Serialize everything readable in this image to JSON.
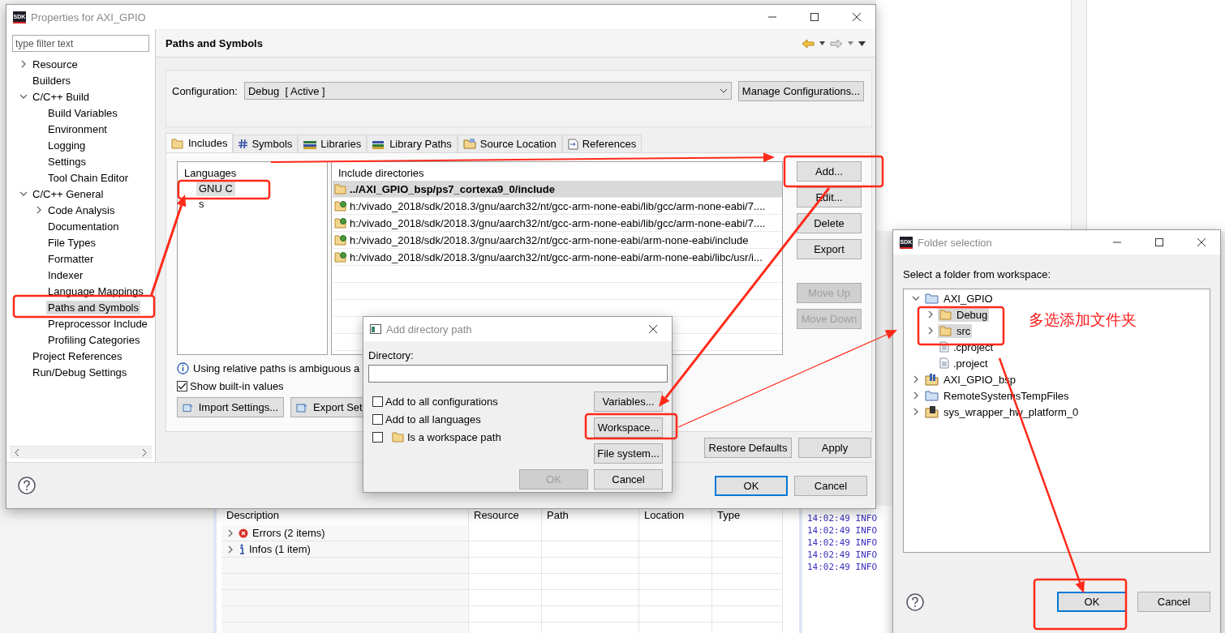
{
  "background": {
    "problems": {
      "columns": [
        "Description",
        "Resource",
        "Path",
        "Location",
        "Type"
      ],
      "rows": [
        {
          "label": "Errors (2 items)",
          "kind": "error"
        },
        {
          "label": "Infos (1 item)",
          "kind": "info"
        }
      ]
    },
    "console_lines": [
      "14:02:49 INFO",
      "14:02:49 INFO",
      "14:02:49 INFO",
      "14:02:49 INFO",
      "14:02:49 INFO"
    ]
  },
  "main_window": {
    "app_badge": "SDK",
    "title": "Properties for AXI_GPIO",
    "filter": {
      "placeholder": "type filter text"
    },
    "nav_tree": [
      {
        "label": "Resource",
        "expanded": false,
        "selected": false
      },
      {
        "label": "Builders",
        "selected": false
      },
      {
        "label": "C/C++ Build",
        "expanded": true,
        "selected": false,
        "children": [
          {
            "label": "Build Variables",
            "selected": false
          },
          {
            "label": "Environment",
            "selected": false
          },
          {
            "label": "Logging",
            "selected": false
          },
          {
            "label": "Settings",
            "selected": false
          },
          {
            "label": "Tool Chain Editor",
            "selected": false
          }
        ]
      },
      {
        "label": "C/C++ General",
        "expanded": true,
        "selected": false,
        "children": [
          {
            "label": "Code Analysis",
            "expanded": false,
            "selected": false
          },
          {
            "label": "Documentation",
            "selected": false
          },
          {
            "label": "File Types",
            "selected": false
          },
          {
            "label": "Formatter",
            "selected": false
          },
          {
            "label": "Indexer",
            "selected": false
          },
          {
            "label": "Language Mappings",
            "selected": false
          },
          {
            "label": "Paths and Symbols",
            "selected": true
          },
          {
            "label": "Preprocessor Include",
            "selected": false
          },
          {
            "label": "Profiling Categories",
            "selected": false
          }
        ]
      },
      {
        "label": "Project References",
        "selected": false
      },
      {
        "label": "Run/Debug Settings",
        "selected": false
      }
    ],
    "page_title": "Paths and Symbols",
    "configuration": {
      "label": "Configuration:",
      "value": "Debug  [ Active ]",
      "manage_button": "Manage Configurations..."
    },
    "tabs": [
      {
        "label": "Includes",
        "selected": true
      },
      {
        "label": "Symbols",
        "selected": false
      },
      {
        "label": "Libraries",
        "selected": false
      },
      {
        "label": "Library Paths",
        "selected": false
      },
      {
        "label": "Source Location",
        "selected": false
      },
      {
        "label": "References",
        "selected": false
      }
    ],
    "languages": {
      "header": "Languages",
      "items": [
        {
          "label": "GNU C",
          "selected": true
        },
        {
          "label": "s",
          "selected": false
        }
      ]
    },
    "include_directories": {
      "header": "Include directories",
      "rows": [
        {
          "path": "../AXI_GPIO_bsp/ps7_cortexa9_0/include",
          "kind": "workspace",
          "selected": true
        },
        {
          "path": "h:/vivado_2018/sdk/2018.3/gnu/aarch32/nt/gcc-arm-none-eabi/lib/gcc/arm-none-eabi/7....",
          "kind": "builtin",
          "selected": false
        },
        {
          "path": "h:/vivado_2018/sdk/2018.3/gnu/aarch32/nt/gcc-arm-none-eabi/lib/gcc/arm-none-eabi/7....",
          "kind": "builtin",
          "selected": false
        },
        {
          "path": "h:/vivado_2018/sdk/2018.3/gnu/aarch32/nt/gcc-arm-none-eabi/arm-none-eabi/include",
          "kind": "builtin",
          "selected": false
        },
        {
          "path": "h:/vivado_2018/sdk/2018.3/gnu/aarch32/nt/gcc-arm-none-eabi/arm-none-eabi/libc/usr/i...",
          "kind": "builtin",
          "selected": false
        }
      ]
    },
    "side_buttons": [
      {
        "label": "Add...",
        "disabled": false
      },
      {
        "label": "Edit...",
        "disabled": false
      },
      {
        "label": "Delete",
        "disabled": false
      },
      {
        "label": "Export",
        "disabled": false
      },
      {
        "label": "Move Up",
        "disabled": true
      },
      {
        "label": "Move Down",
        "disabled": true
      }
    ],
    "info": "Using relative paths is ambiguous a",
    "show_builtin": {
      "label": "Show built-in values",
      "checked": true
    },
    "import_button": "Import Settings...",
    "export_button": "Export Set",
    "restore_button": "Restore Defaults",
    "apply_button": "Apply",
    "ok_button": "OK",
    "cancel_button": "Cancel"
  },
  "add_dialog": {
    "title": "Add directory path",
    "directory_label": "Directory:",
    "options": [
      {
        "label": "Add to all configurations",
        "checked": false,
        "kind": "plain"
      },
      {
        "label": "Add to all languages",
        "checked": false,
        "kind": "plain"
      },
      {
        "label": "Is a workspace path",
        "checked": false,
        "kind": "folder"
      }
    ],
    "buttons": [
      "Variables...",
      "Workspace...",
      "File system..."
    ],
    "ok": {
      "label": "OK",
      "disabled": true
    },
    "cancel": "Cancel"
  },
  "folder_dialog": {
    "app_badge": "SDK",
    "title": "Folder selection",
    "prompt": "Select a folder from workspace:",
    "tree": [
      {
        "label": "AXI_GPIO",
        "kind": "project",
        "expanded": true,
        "selected": false,
        "children": [
          {
            "label": "Debug",
            "kind": "folder",
            "expanded": false,
            "selected": true
          },
          {
            "label": "src",
            "kind": "folder",
            "expanded": false,
            "selected": true
          },
          {
            "label": ".cproject",
            "kind": "file",
            "selected": false
          },
          {
            "label": ".project",
            "kind": "file",
            "selected": false
          }
        ]
      },
      {
        "label": "AXI_GPIO_bsp",
        "kind": "bsp",
        "expanded": false,
        "selected": false
      },
      {
        "label": "RemoteSystemsTempFiles",
        "kind": "project",
        "expanded": false,
        "selected": false
      },
      {
        "label": "sys_wrapper_hw_platform_0",
        "kind": "chip",
        "expanded": false,
        "selected": false
      }
    ],
    "ok_button": "OK",
    "cancel_button": "Cancel"
  },
  "annotation": {
    "note": "多选添加文件夹"
  }
}
